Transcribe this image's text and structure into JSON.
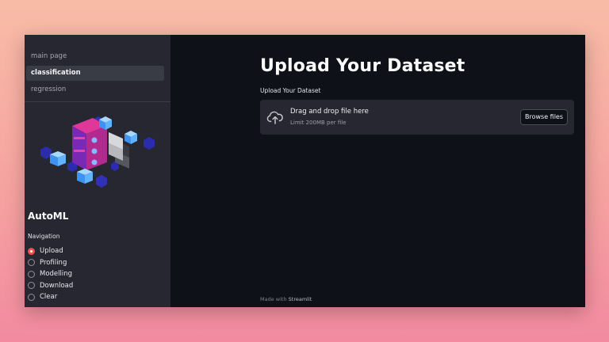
{
  "sidebar": {
    "pages": [
      {
        "label": "main page",
        "active": false
      },
      {
        "label": "classification",
        "active": true
      },
      {
        "label": "regression",
        "active": false
      }
    ],
    "app_title": "AutoML",
    "navigation_label": "Navigation",
    "radio_options": [
      {
        "label": "Upload",
        "selected": true
      },
      {
        "label": "Profiling",
        "selected": false
      },
      {
        "label": "Modelling",
        "selected": false
      },
      {
        "label": "Download",
        "selected": false
      },
      {
        "label": "Clear",
        "selected": false
      }
    ]
  },
  "main": {
    "heading": "Upload Your Dataset",
    "uploader": {
      "label": "Upload Your Dataset",
      "title": "Drag and drop file here",
      "subtitle": "Limit 200MB per file",
      "button": "Browse files"
    },
    "footer": {
      "prefix": "Made with",
      "brand": "Streamlit"
    }
  },
  "colors": {
    "sidebar_bg": "#262730",
    "main_bg": "#0e1117",
    "accent_red": "#ff4b4b",
    "active_page_bg": "#393b45"
  },
  "icons": {
    "upload": "cloud-upload-icon",
    "hero": "isometric-data-illustration"
  }
}
